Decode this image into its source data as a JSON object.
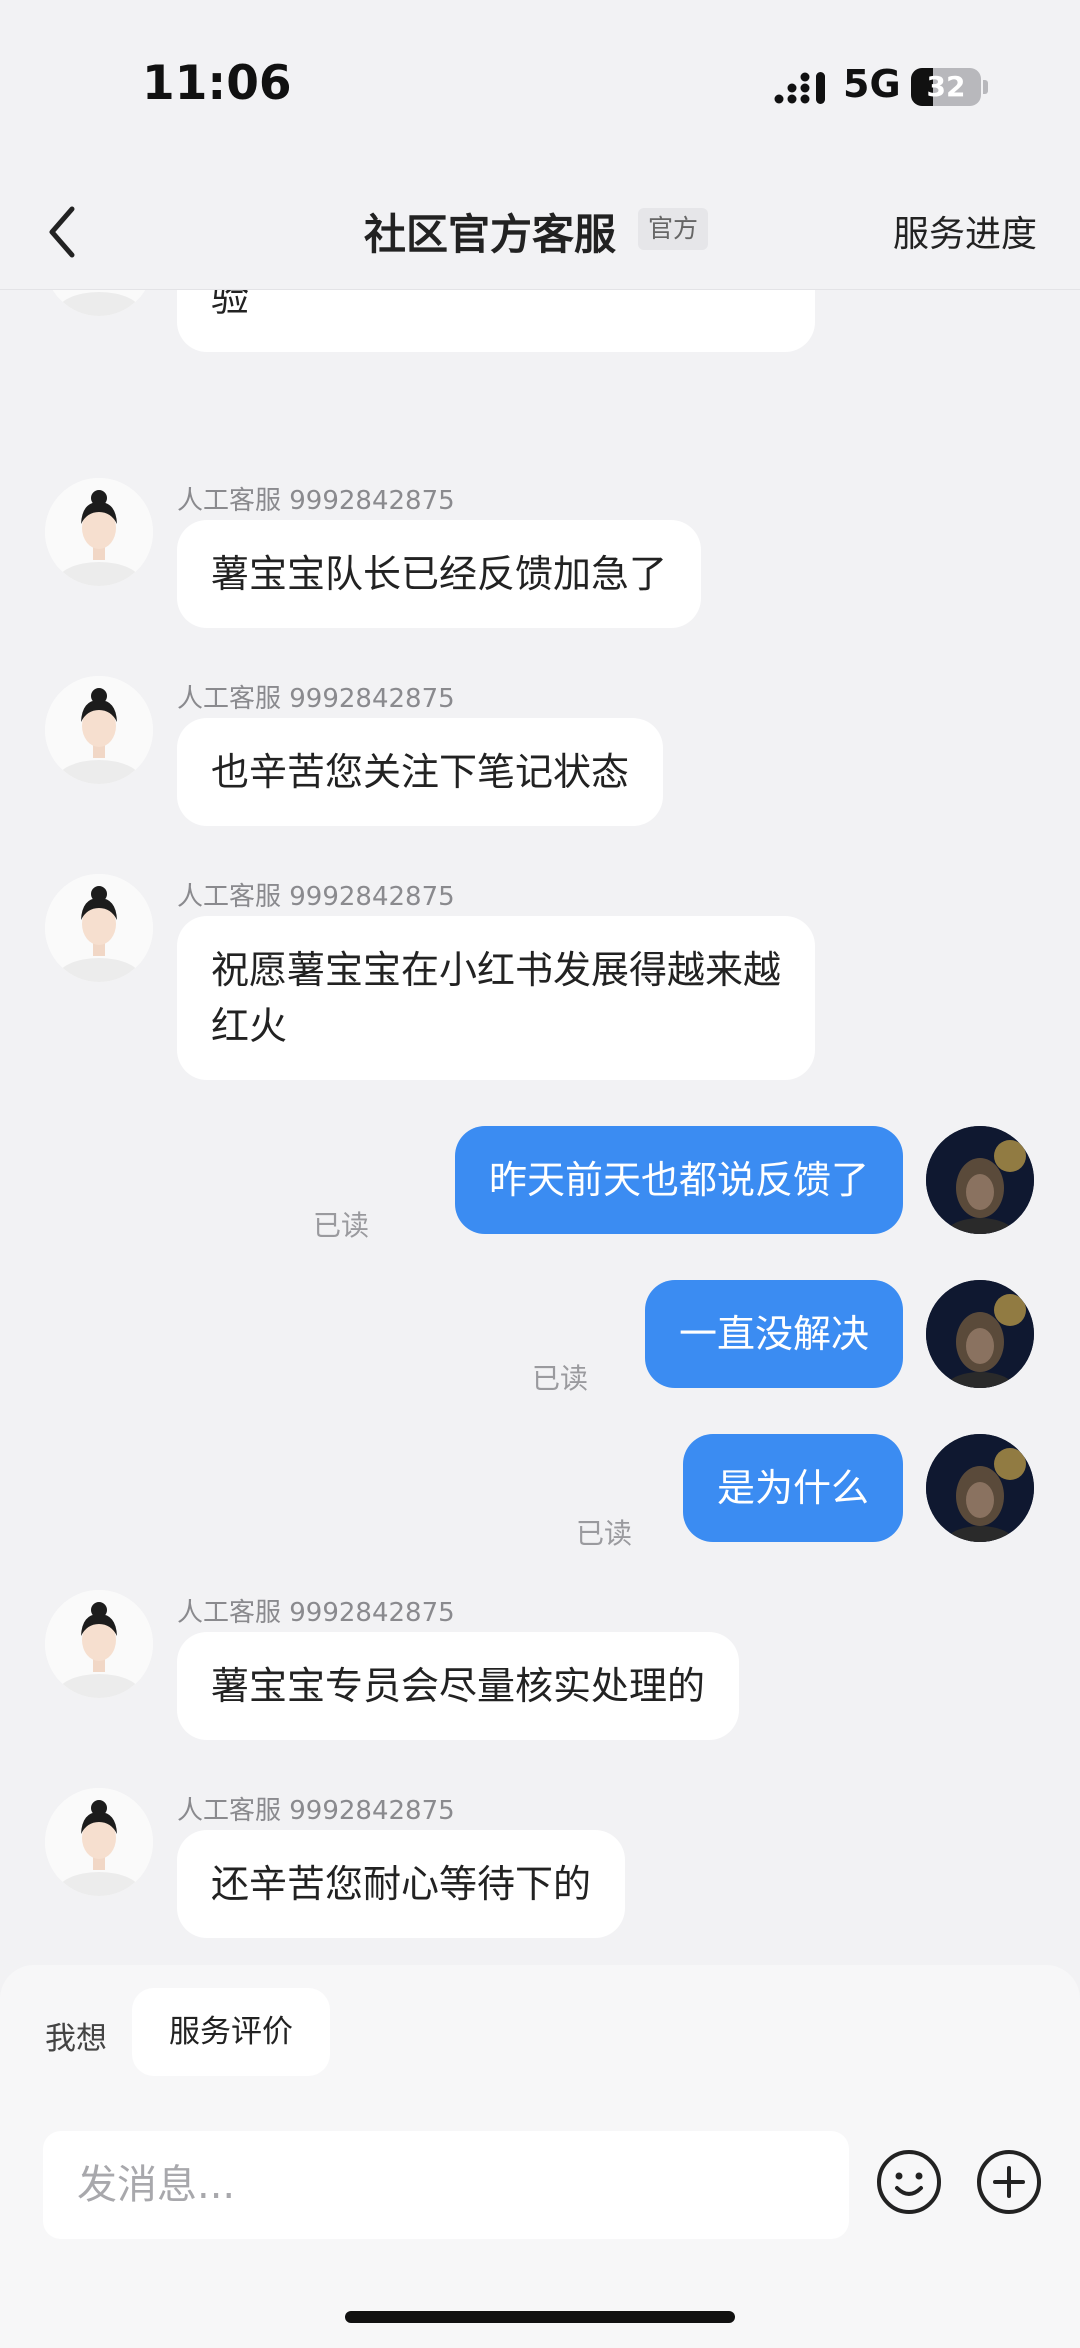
{
  "status_bar": {
    "time": "11:06",
    "network": "5G",
    "battery": "32",
    "battery_level": 0.32
  },
  "nav": {
    "back_icon": "chevron-left-icon",
    "title": "社区官方客服",
    "tag": "官方",
    "right_link": "服务进度"
  },
  "messages": [
    {
      "side": "in",
      "sender": "",
      "text": "薯宝宝很抱歉给您带来不愉快的体\n验"
    },
    {
      "side": "in",
      "sender": "人工客服 9992842875",
      "text": "薯宝宝队长已经反馈加急了"
    },
    {
      "side": "in",
      "sender": "人工客服 9992842875",
      "text": "也辛苦您关注下笔记状态"
    },
    {
      "side": "in",
      "sender": "人工客服 9992842875",
      "text": "祝愿薯宝宝在小红书发展得越来越\n红火"
    },
    {
      "side": "out",
      "status": "已读",
      "text": "昨天前天也都说反馈了"
    },
    {
      "side": "out",
      "status": "已读",
      "text": "一直没解决"
    },
    {
      "side": "out",
      "status": "已读",
      "text": "是为什么"
    },
    {
      "side": "in",
      "sender": "人工客服 9992842875",
      "text": "薯宝宝专员会尽量核实处理的"
    },
    {
      "side": "in",
      "sender": "人工客服 9992842875",
      "text": "还辛苦您耐心等待下的"
    }
  ],
  "quick_reply": {
    "label": "我想",
    "chip": "服务评价"
  },
  "composer": {
    "placeholder": "发消息...",
    "emoji_icon": "emoji-icon",
    "plus_icon": "plus-icon"
  },
  "colors": {
    "accent": "#3b8cf2",
    "background": "#f2f2f4",
    "bubble_in": "#ffffff"
  }
}
